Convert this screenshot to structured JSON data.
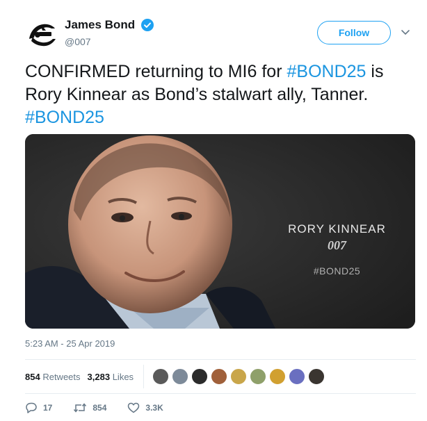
{
  "author": {
    "display_name": "James Bond",
    "handle": "@007",
    "avatar_icon": "bond-gun-logo-icon",
    "verified_icon": "verified-badge-icon"
  },
  "follow_button": {
    "label": "Follow"
  },
  "menu": {
    "icon": "chevron-down-icon"
  },
  "tweet": {
    "text_part1": "CONFIRMED returning to MI6 for ",
    "hashtag1": "#BOND25",
    "text_part2": " is Rory Kinnear as Bond’s stalwart ally, Tanner. ",
    "hashtag2": "#BOND25"
  },
  "media": {
    "name": "RORY KINNEAR",
    "logo": "007",
    "hashtag": "#BOND25"
  },
  "timestamp": "5:23 AM - 25 Apr 2019",
  "stats": {
    "retweets_count": "854",
    "retweets_label": "Retweets",
    "likes_count": "3,283",
    "likes_label": "Likes"
  },
  "actions": {
    "reply_count": "17",
    "retweet_count": "854",
    "like_count": "3.3K"
  },
  "colors": {
    "accent": "#1da1f2",
    "hashtag": "#1b95e0",
    "muted": "#657786"
  }
}
